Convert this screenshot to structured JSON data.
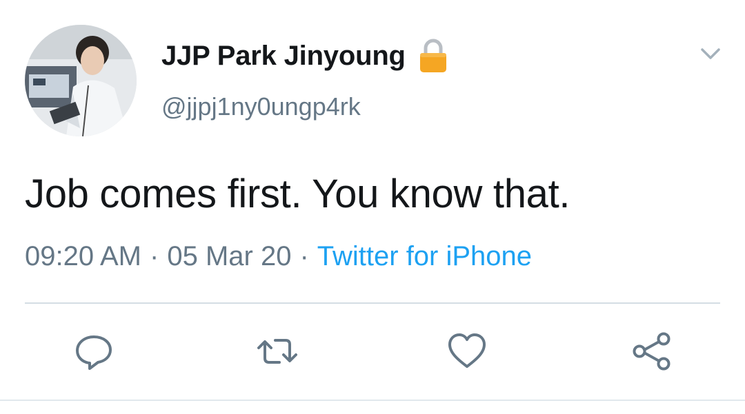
{
  "author": {
    "display_name": "JJP Park Jinyoung",
    "handle": "@jjpj1ny0ungp4rk",
    "protected_icon": "lock-icon"
  },
  "tweet": {
    "text": "Job comes first. You know that.",
    "time": "09:20 AM",
    "date": "05 Mar 20",
    "separator": "·",
    "source": "Twitter for iPhone"
  },
  "actions": [
    {
      "name": "reply",
      "icon": "reply-icon"
    },
    {
      "name": "retweet",
      "icon": "retweet-icon"
    },
    {
      "name": "like",
      "icon": "heart-icon"
    },
    {
      "name": "share",
      "icon": "share-icon"
    }
  ],
  "colors": {
    "text": "#14171a",
    "secondary": "#657786",
    "link": "#1da1f2",
    "divider": "#d4dde4",
    "lock": "#f5a623"
  }
}
